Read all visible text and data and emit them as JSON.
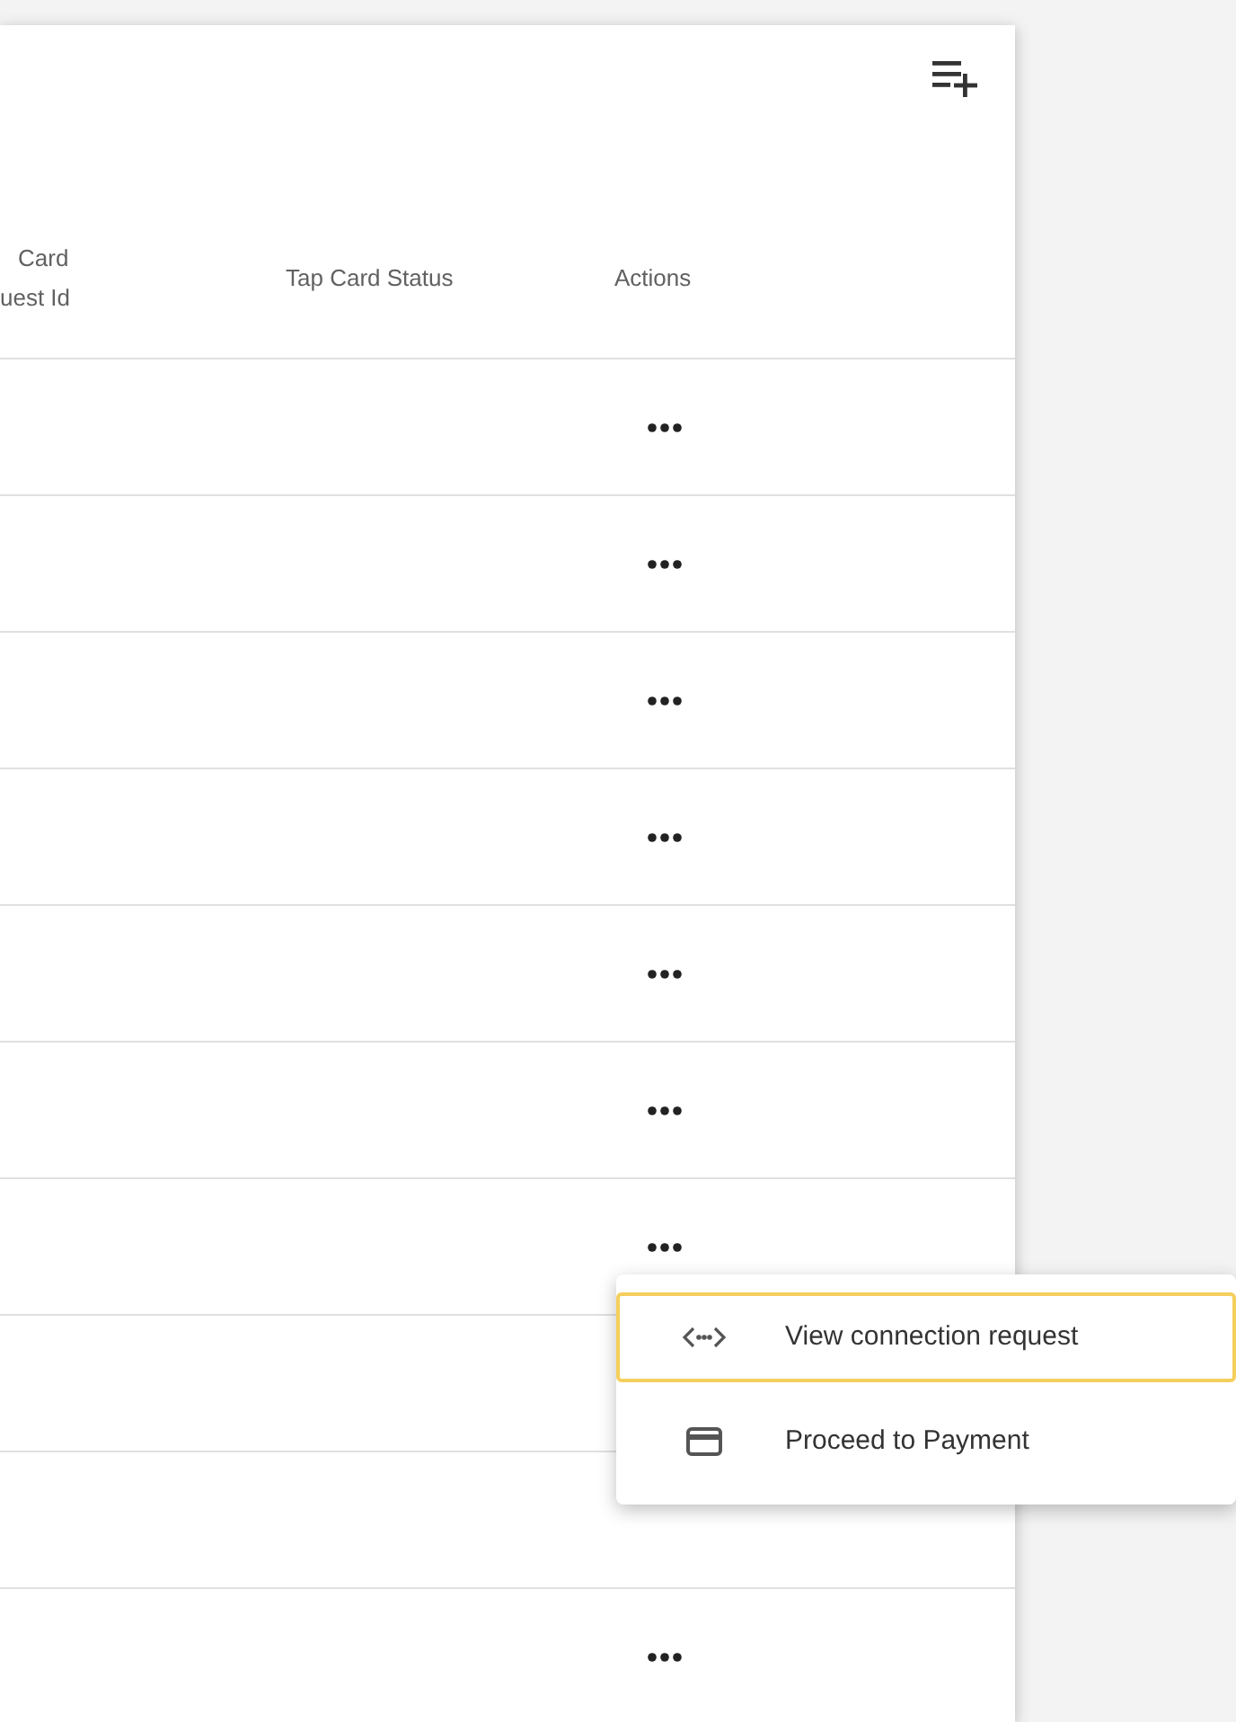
{
  "table": {
    "columns": [
      {
        "lines": [
          "Card",
          "uest Id"
        ]
      },
      {
        "lines": [
          "Tap Card Status"
        ]
      },
      {
        "lines": [
          "Actions"
        ]
      }
    ],
    "rows": [
      {
        "kind": "actions"
      },
      {
        "kind": "actions"
      },
      {
        "kind": "actions"
      },
      {
        "kind": "actions"
      },
      {
        "kind": "actions"
      },
      {
        "kind": "actions"
      },
      {
        "kind": "actions"
      },
      {
        "kind": "covered"
      },
      {
        "kind": "covered"
      },
      {
        "kind": "actions"
      }
    ]
  },
  "menu": {
    "items": [
      {
        "kind": "connection",
        "label": "View connection request",
        "selected": true
      },
      {
        "kind": "payment",
        "label": "Proceed to Payment",
        "selected": false
      }
    ]
  }
}
